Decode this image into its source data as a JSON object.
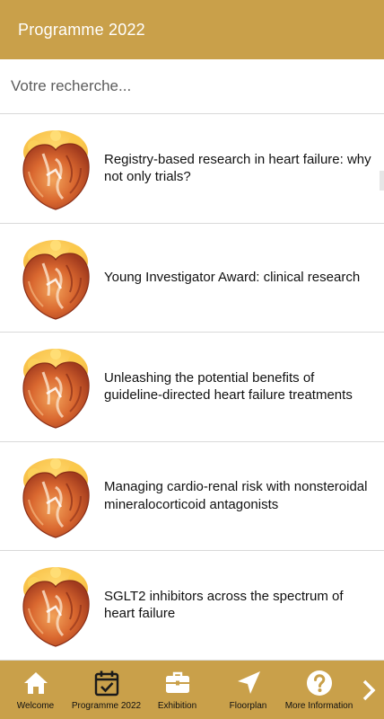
{
  "header": {
    "title": "Programme 2022"
  },
  "search": {
    "placeholder": "Votre recherche..."
  },
  "sessions": [
    {
      "title": "Registry-based research in heart failure: why not only trials?",
      "icon": "heart-image"
    },
    {
      "title": "Young Investigator Award: clinical research",
      "icon": "heart-image"
    },
    {
      "title": "Unleashing the potential benefits of guideline-directed heart failure treatments",
      "icon": "heart-image"
    },
    {
      "title": "Managing cardio-renal risk with nonsteroidal mineralocorticoid antagonists",
      "icon": "heart-image"
    },
    {
      "title": "SGLT2 inhibitors across the spectrum of heart failure",
      "icon": "heart-image"
    }
  ],
  "nav": {
    "items": [
      {
        "label": "Welcome",
        "icon": "home-icon"
      },
      {
        "label": "Programme 2022",
        "icon": "calendar-check-icon"
      },
      {
        "label": "Exhibition",
        "icon": "briefcase-icon"
      },
      {
        "label": "Floorplan",
        "icon": "navigation-arrow-icon"
      },
      {
        "label": "More Information",
        "icon": "help-icon"
      }
    ],
    "next_icon": "chevron-right-icon"
  },
  "colors": {
    "brand": "#c9a04a",
    "header_text": "#ffffff",
    "divider": "#d9d9d9"
  }
}
